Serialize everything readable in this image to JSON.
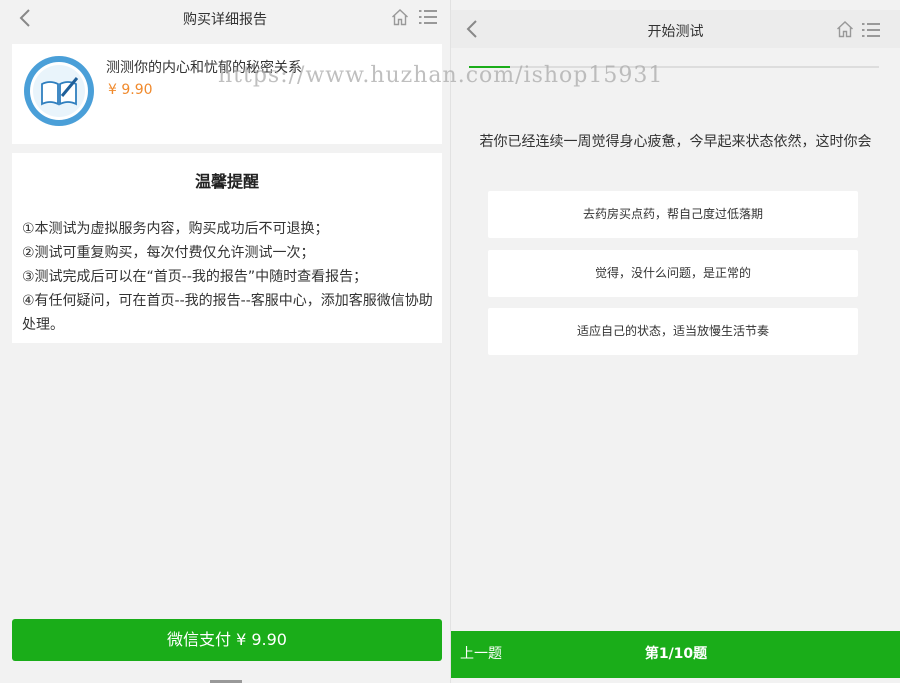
{
  "left": {
    "title": "购买详细报告",
    "product": {
      "name": "测测你的内心和忧郁的秘密关系",
      "price": "¥ 9.90"
    },
    "notice": {
      "title": "温馨提醒",
      "items": [
        "①本测试为虚拟服务内容，购买成功后不可退换；",
        "②测试可重复购买，每次付费仅允许测试一次；",
        "③测试完成后可以在“首页--我的报告”中随时查看报告；",
        "④有任何疑问，可在首页--我的报告--客服中心，添加客服微信协助处理。"
      ]
    },
    "pay_label": "微信支付 ¥ 9.90"
  },
  "right": {
    "title": "开始测试",
    "question": "若你已经连续一周觉得身心疲惫，今早起来状态依然，这时你会",
    "options": [
      "去药房买点药，帮自己度过低落期",
      "觉得，没什么问题，是正常的",
      "适应自己的状态，适当放慢生活节奏"
    ],
    "progress": 0.1,
    "prev_label": "上一题",
    "counter": "第1/10题"
  },
  "watermark": "https://www.huzhan.com/ishop15931",
  "colors": {
    "brand_green": "#1aad19",
    "price_orange": "#f08a2d",
    "background": "#f2f2f2"
  },
  "icons": [
    "back-chevron-icon",
    "home-icon",
    "menu-list-icon",
    "book-logo-icon"
  ]
}
